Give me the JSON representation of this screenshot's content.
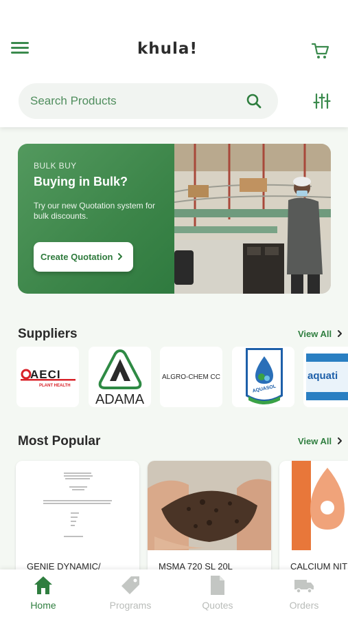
{
  "header": {
    "logo": "khula!",
    "search_placeholder": "Search Products",
    "icons": [
      "menu-icon",
      "cart-icon",
      "search-icon",
      "filter-icon"
    ]
  },
  "banner": {
    "eyebrow": "BULK BUY",
    "title": "Buying in Bulk?",
    "text": "Try our new Quotation system for bulk discounts.",
    "cta": "Create Quotation"
  },
  "suppliers": {
    "title": "Suppliers",
    "view_all": "View All",
    "items": [
      {
        "name": "AECI",
        "tagline": "PLANT HEALTH"
      },
      {
        "name": "ADAMA"
      },
      {
        "name": "ALGRO-CHEM CC"
      },
      {
        "name": "AQUASOL"
      },
      {
        "name": "aquati"
      }
    ]
  },
  "popular": {
    "title": "Most Popular",
    "view_all": "View All",
    "items": [
      {
        "name": "GENIE DYNAMIC/"
      },
      {
        "name": "MSMA 720 SL 20L"
      },
      {
        "name": "CALCIUM NITI"
      }
    ]
  },
  "nav": {
    "items": [
      {
        "label": "Home",
        "icon": "home-icon",
        "active": true
      },
      {
        "label": "Programs",
        "icon": "tag-icon",
        "active": false
      },
      {
        "label": "Quotes",
        "icon": "document-icon",
        "active": false
      },
      {
        "label": "Orders",
        "icon": "truck-icon",
        "active": false
      }
    ]
  },
  "colors": {
    "brand_green": "#2f7e3f",
    "background": "#f4f8f3",
    "inactive": "#b9bcb9"
  }
}
